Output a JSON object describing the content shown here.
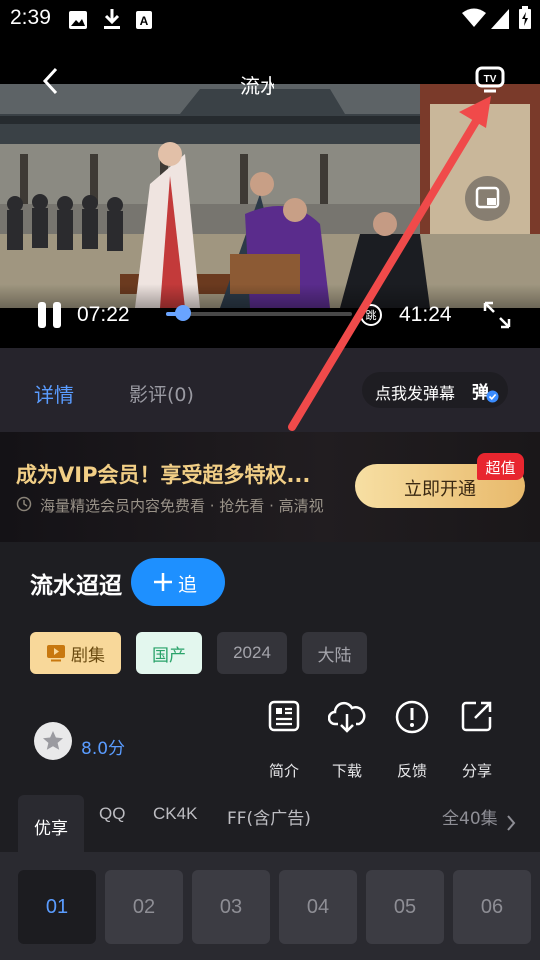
{
  "status_bar": {
    "time": "2:39"
  },
  "player": {
    "title": "流水",
    "current_time": "07:22",
    "total_time": "41:24",
    "skip_label": "跳",
    "progress": 0.09
  },
  "detail_tabs": {
    "detail": "详情",
    "reviews": "影评(0)",
    "danmaku_button": "点我发弹幕",
    "danmaku_toggle": "弹"
  },
  "vip_banner": {
    "headline": "成为VIP会员！享受超多特权...",
    "subtitle": "海量精选会员内容免费看 · 抢先看 · 高清视",
    "button": "立即开通",
    "badge": "超值"
  },
  "show": {
    "title": "流水迢迢",
    "follow_button": "追",
    "tags": [
      "剧集",
      "国产",
      "2024",
      "大陆"
    ],
    "rating": "8.0分"
  },
  "actions": [
    {
      "label": "简介",
      "icon": "document-icon"
    },
    {
      "label": "下载",
      "icon": "cloud-download-icon"
    },
    {
      "label": "反馈",
      "icon": "alert-icon"
    },
    {
      "label": "分享",
      "icon": "share-icon"
    }
  ],
  "sources": {
    "tabs": [
      "优享",
      "QQ",
      "CK4K",
      "FF(含广告)"
    ],
    "all_episodes": "全40集"
  },
  "episodes": [
    "01",
    "02",
    "03",
    "04",
    "05",
    "06"
  ],
  "colors": {
    "accent_blue": "#1e90ff",
    "annotation_red": "#f04a4a",
    "vip_gold": "#f2cf86"
  }
}
